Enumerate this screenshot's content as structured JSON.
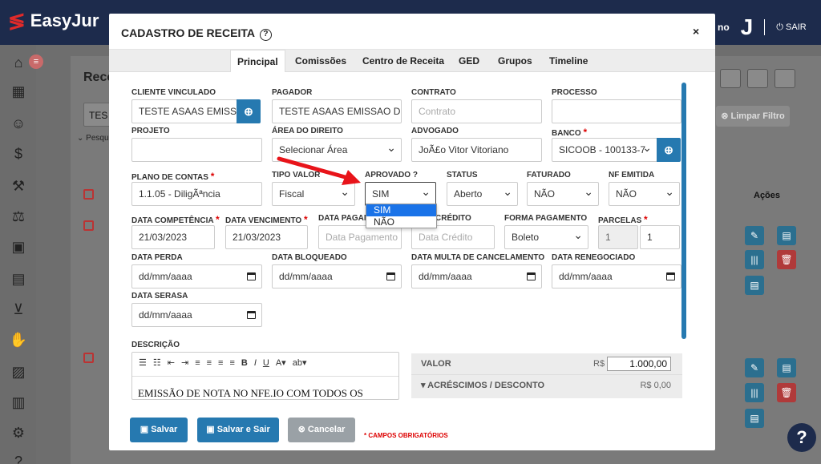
{
  "app": {
    "brand": "EasyJur",
    "user_fragment": "no",
    "user_initial": "J",
    "exit_label": "SAIR"
  },
  "background": {
    "title": "Rece",
    "search_value": "TES",
    "search_hint": "Pesqu",
    "limpar_label": "Limpar Filtro",
    "acoes_label": "Ações",
    "row_frag": "2"
  },
  "modal": {
    "title": "CADASTRO DE RECEITA",
    "close": "×",
    "tabs": [
      "Principal",
      "Comissões",
      "Centro de Receita",
      "GED",
      "Grupos",
      "Timeline"
    ],
    "fields": {
      "cliente_label": "CLIENTE VINCULADO",
      "cliente_value": "TESTE ASAAS EMISSÃ",
      "pagador_label": "PAGADOR",
      "pagador_value": "TESTE ASAAS EMISSAO DE",
      "contrato_label": "CONTRATO",
      "contrato_placeholder": "Contrato",
      "processo_label": "PROCESSO",
      "projeto_label": "PROJETO",
      "area_label": "ÁREA DO DIREITO",
      "area_value": "Selecionar Área",
      "advogado_label": "ADVOGADO",
      "advogado_value": "JoÃ£o Vitor Vitoriano",
      "banco_label": "BANCO",
      "banco_value": "SICOOB - 100133-7",
      "plano_label": "PLANO DE CONTAS",
      "plano_value": "1.1.05 - DiligÃªncia",
      "tipo_label": "TIPO VALOR",
      "tipo_value": "Fiscal",
      "aprovado_label": "APROVADO ?",
      "aprovado_value": "SIM",
      "status_label": "STATUS",
      "status_value": "Aberto",
      "faturado_label": "FATURADO",
      "faturado_value": "NÃO",
      "nf_label": "NF EMITIDA",
      "nf_value": "NÃO",
      "competencia_label": "DATA COMPETÊNCIA",
      "competencia_value": "21/03/2023",
      "vencimento_label": "DATA VENCIMENTO",
      "vencimento_value": "21/03/2023",
      "pagamento_label": "DATA PAGAM",
      "pagamento_placeholder": "Data Pagamento",
      "credito_label": "CRÉDITO",
      "credito_placeholder": "Data Crédito",
      "forma_label": "FORMA PAGAMENTO",
      "forma_value": "Boleto",
      "parcelas_label": "PARCELAS",
      "parcelas_a": "1",
      "parcelas_b": "1",
      "perda_label": "DATA PERDA",
      "bloqueado_label": "DATA BLOQUEADO",
      "multa_label": "DATA MULTA DE CANCELAMENTO",
      "renegociado_label": "DATA RENEGOCIADO",
      "serasa_label": "DATA SERASA",
      "date_placeholder": "dd/mm/aaaa",
      "descricao_label": "DESCRIÇÃO",
      "descricao_text": "EMISSÃO DE NOTA NO NFE.IO COM TODOS OS"
    },
    "dropdown_options": [
      "SIM",
      "NÃO"
    ],
    "valor": {
      "label": "VALOR",
      "currency": "R$",
      "value": "1.000,00",
      "acresc_label": "ACRÉSCIMOS / DESCONTO",
      "acresc_value": "R$ 0,00"
    },
    "buttons": {
      "salvar": "Salvar",
      "salvar_sair": "Salvar e Sair",
      "cancelar": "Cancelar"
    },
    "obrigatorios": "* CAMPOS OBRIGATÓRIOS"
  },
  "colors": {
    "primary": "#2679b0",
    "navbar": "#1d2b4c",
    "required": "#dd0000",
    "arrow": "#e8141a"
  }
}
